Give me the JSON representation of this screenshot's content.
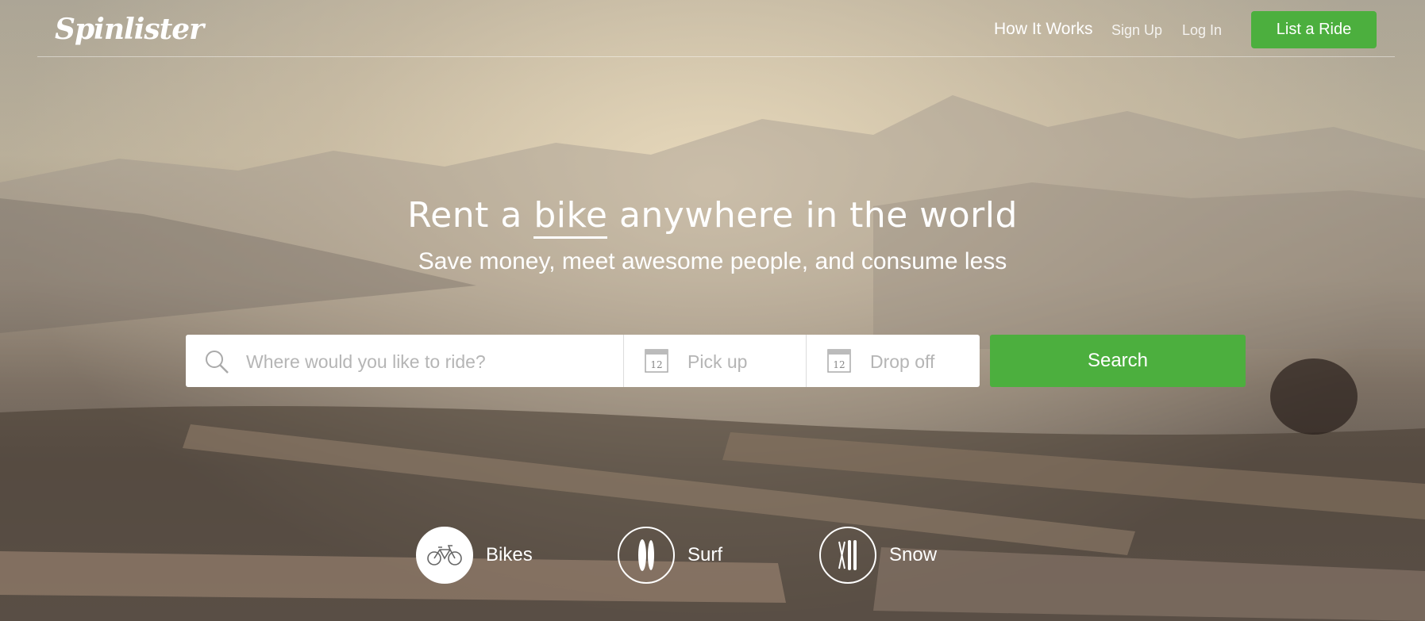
{
  "brand": {
    "logo_text": "Spinlister",
    "accent_color": "#4caf3e"
  },
  "nav": {
    "how_it_works": "How It Works",
    "sign_up": "Sign Up",
    "log_in": "Log In",
    "list_ride": "List a Ride"
  },
  "hero": {
    "headline_prefix": "Rent a ",
    "headline_keyword": "bike",
    "headline_suffix": " anywhere in the world",
    "subheadline": "Save money, meet awesome people, and consume less"
  },
  "search": {
    "where_placeholder": "Where would you like to ride?",
    "pickup_placeholder": "Pick up",
    "dropoff_placeholder": "Drop off",
    "calendar_day": "12",
    "button_label": "Search"
  },
  "categories": [
    {
      "label": "Bikes",
      "icon": "bicycle-icon",
      "selected": true
    },
    {
      "label": "Surf",
      "icon": "surfboard-icon",
      "selected": false
    },
    {
      "label": "Snow",
      "icon": "ski-icon",
      "selected": false
    }
  ]
}
